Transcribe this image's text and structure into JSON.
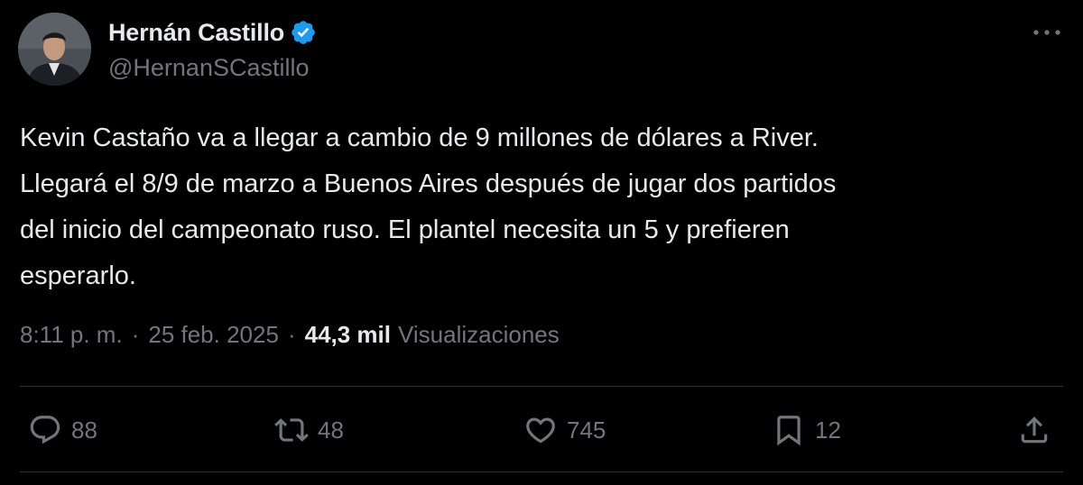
{
  "author": {
    "display_name": "Hernán Castillo",
    "handle": "@HernanSCastillo",
    "verified": true
  },
  "tweet": {
    "text": "Kevin Castaño va a llegar a cambio de 9 millones de dólares a River.\nLlegará el 8/9 de marzo a Buenos Aires después de jugar dos partidos\ndel inicio del campeonato ruso. El plantel necesita un 5 y prefieren\nesperarlo.",
    "time": "8:11 p. m.",
    "separator": "·",
    "date": "25 feb. 2025",
    "views_count": "44,3 mil",
    "views_label": "Visualizaciones"
  },
  "actions": {
    "reply_count": "88",
    "retweet_count": "48",
    "like_count": "745",
    "bookmark_count": "12"
  },
  "icons": {
    "verified": "verified-badge-icon",
    "more": "more-horizontal-icon",
    "reply": "reply-bubble-icon",
    "retweet": "retweet-icon",
    "like": "heart-icon",
    "bookmark": "bookmark-icon",
    "share": "share-icon"
  },
  "colors": {
    "background": "#000000",
    "text_primary": "#e7e9ea",
    "text_secondary": "#71767b",
    "verified_blue": "#1d9bf0",
    "divider": "#2f3336"
  }
}
